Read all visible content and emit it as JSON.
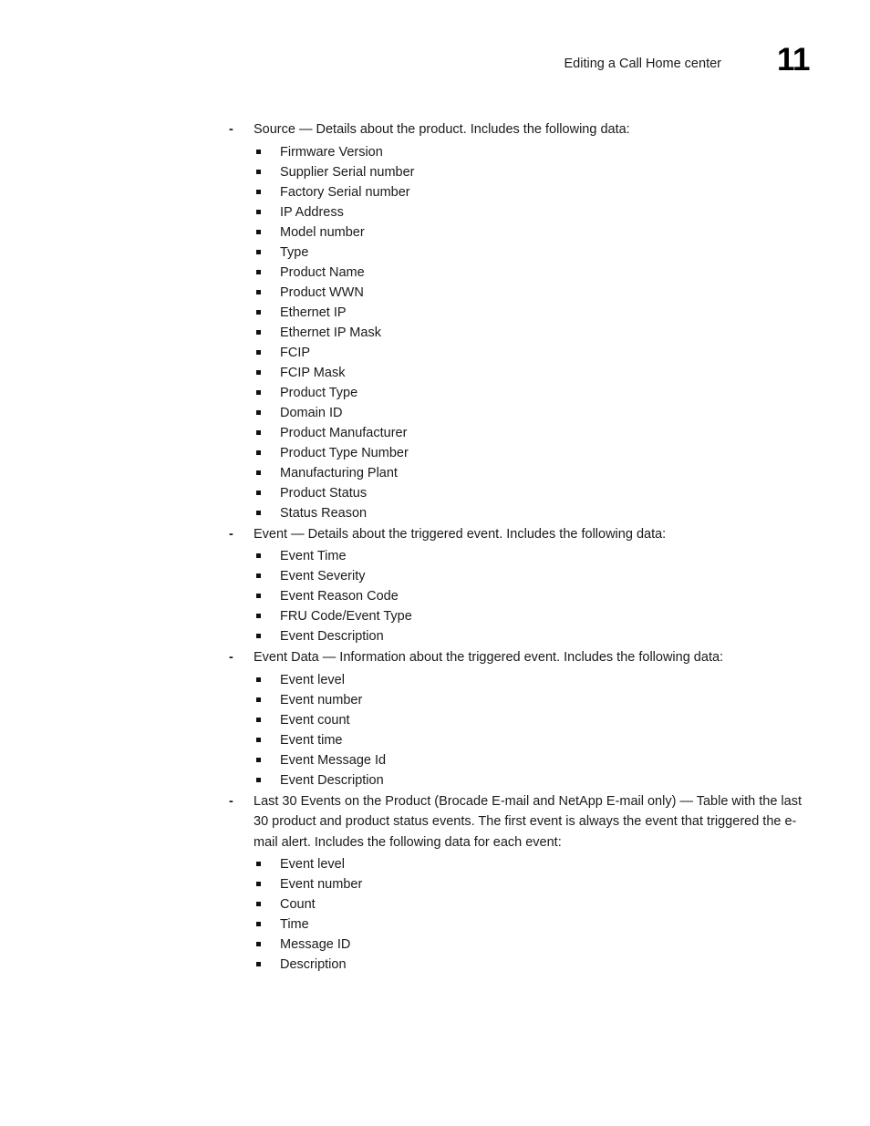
{
  "header": {
    "title": "Editing a Call Home center",
    "folio": "11"
  },
  "markers": {
    "dash": "-",
    "square": "square-bullet"
  },
  "groups": [
    {
      "lead": "Source — Details about the product. Includes the following data:",
      "items": [
        "Firmware Version",
        "Supplier Serial number",
        "Factory Serial number",
        "IP Address",
        "Model number",
        "Type",
        "Product Name",
        "Product WWN",
        "Ethernet IP",
        "Ethernet IP Mask",
        "FCIP",
        "FCIP Mask",
        "Product Type",
        "Domain ID",
        "Product Manufacturer",
        "Product Type Number",
        "Manufacturing Plant",
        "Product Status",
        "Status Reason"
      ]
    },
    {
      "lead": "Event — Details about the triggered event. Includes the following data:",
      "items": [
        "Event Time",
        "Event Severity",
        "Event Reason Code",
        "FRU Code/Event Type",
        "Event Description"
      ]
    },
    {
      "lead": "Event Data — Information about the triggered event. Includes the following data:",
      "items": [
        "Event level",
        "Event number",
        "Event count",
        "Event time",
        "Event Message Id",
        "Event Description"
      ]
    },
    {
      "lead": "Last 30 Events on the Product (Brocade E-mail and NetApp E-mail only) — Table with the last 30 product and product status events. The first event is always the event that triggered the e-mail alert. Includes the following data for each event:",
      "items": [
        "Event level",
        "Event number",
        "Count",
        "Time",
        "Message ID",
        "Description"
      ]
    }
  ]
}
